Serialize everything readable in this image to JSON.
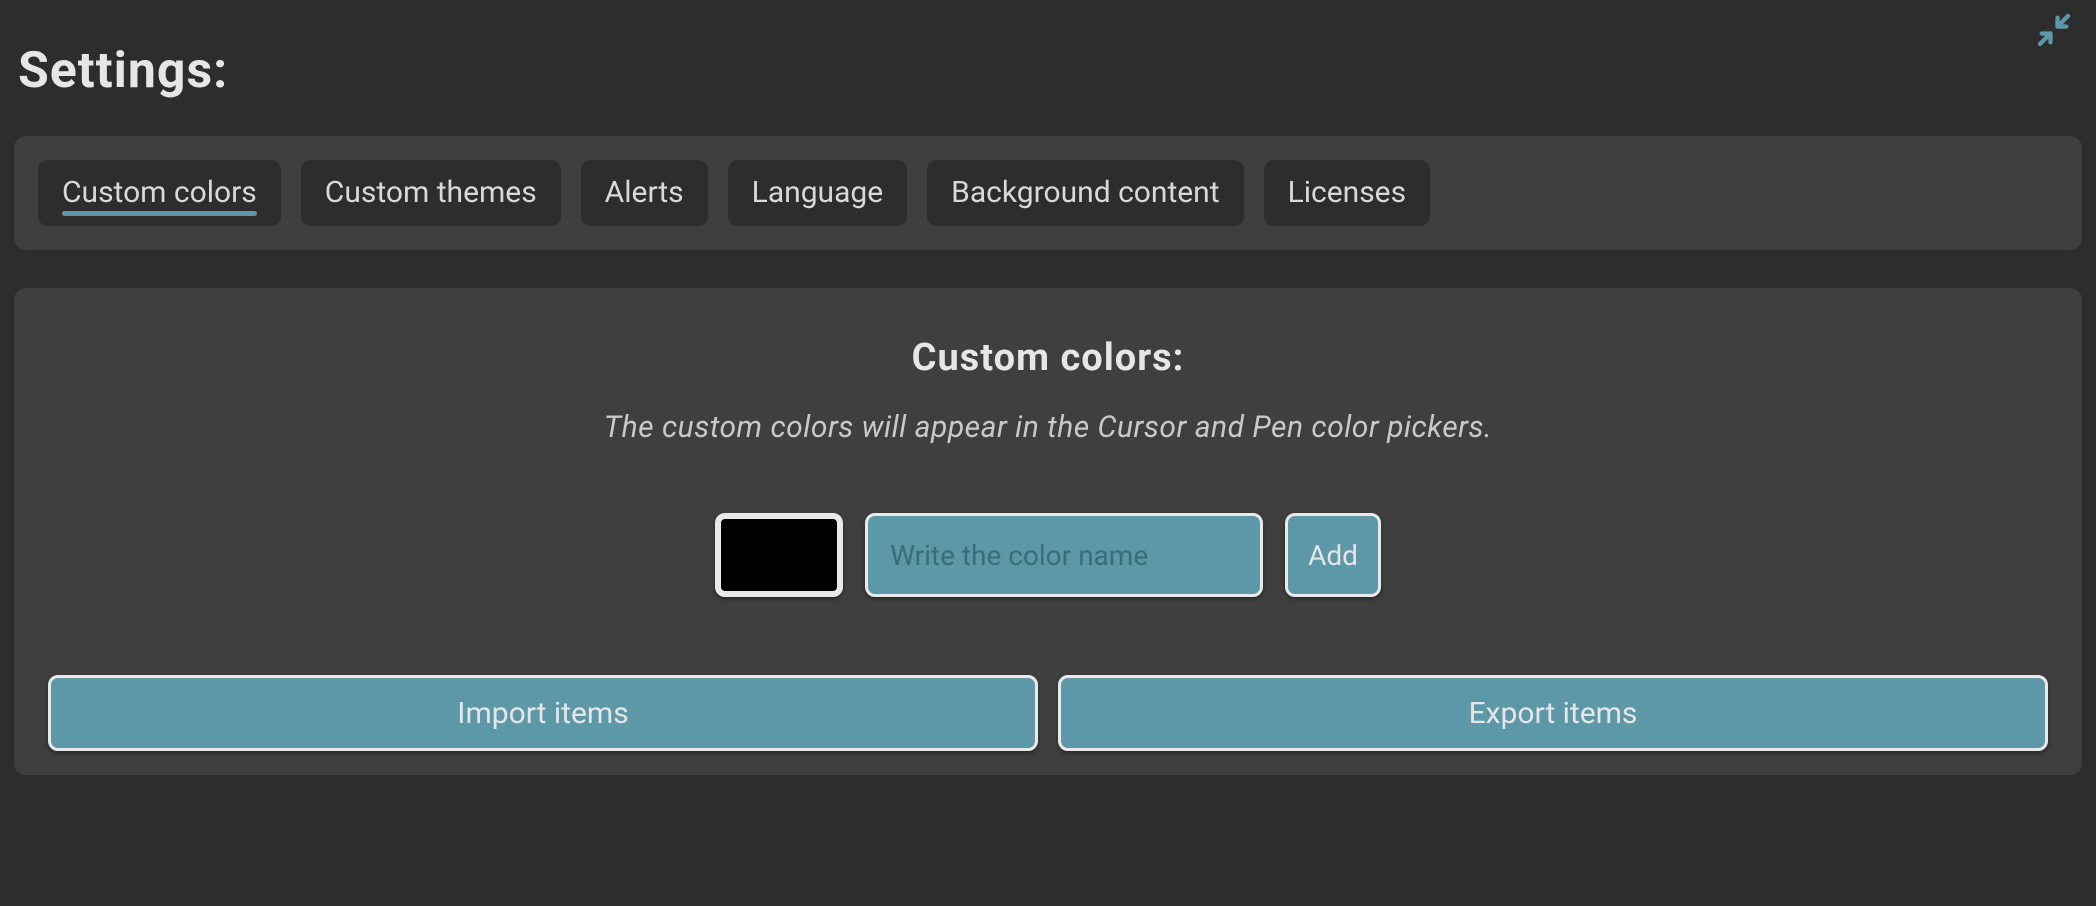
{
  "header": {
    "title": "Settings:"
  },
  "icons": {
    "collapse": "collapse-icon"
  },
  "tabs": [
    {
      "id": "custom-colors",
      "label": "Custom colors",
      "active": true
    },
    {
      "id": "custom-themes",
      "label": "Custom themes",
      "active": false
    },
    {
      "id": "alerts",
      "label": "Alerts",
      "active": false
    },
    {
      "id": "language",
      "label": "Language",
      "active": false
    },
    {
      "id": "background-content",
      "label": "Background content",
      "active": false
    },
    {
      "id": "licenses",
      "label": "Licenses",
      "active": false
    }
  ],
  "section": {
    "title": "Custom colors:",
    "description": "The custom colors will appear in the Cursor and Pen color pickers."
  },
  "add_form": {
    "swatch_color": "#000000",
    "name_value": "",
    "name_placeholder": "Write the color name",
    "add_label": "Add"
  },
  "io": {
    "import_label": "Import items",
    "export_label": "Export items"
  },
  "colors": {
    "accent": "#5c98a8",
    "panel": "#3f3f3f",
    "bg": "#2d2d2d"
  }
}
